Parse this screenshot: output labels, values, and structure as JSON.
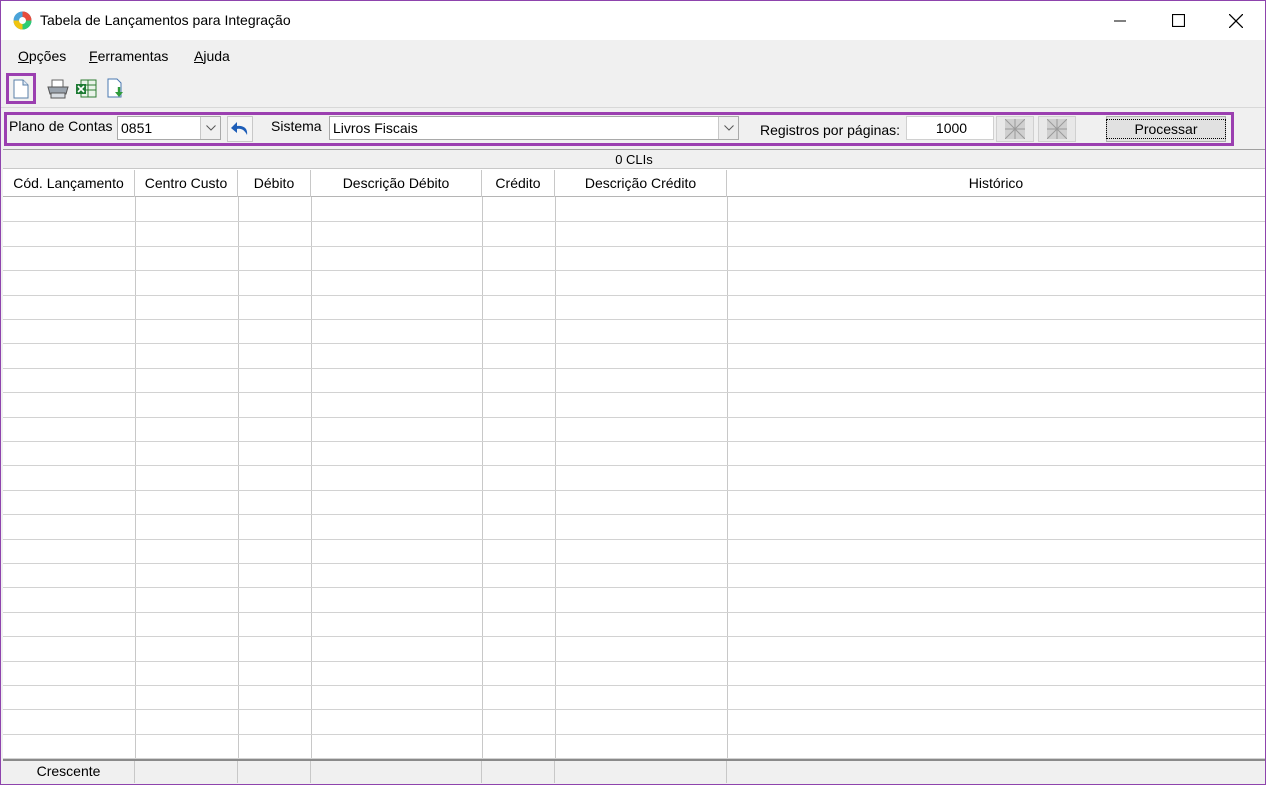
{
  "window": {
    "title": "Tabela de Lançamentos para Integração"
  },
  "menu": {
    "opcoes": {
      "hotkey": "O",
      "rest": "pções"
    },
    "ferramentas": {
      "hotkey": "F",
      "rest": "erramentas"
    },
    "ajuda": {
      "hotkey": "A",
      "rest": "juda"
    }
  },
  "toolbar": {
    "icons": [
      "new-document-icon",
      "print-icon",
      "excel-export-icon",
      "import-icon"
    ]
  },
  "filters": {
    "plano_label": "Plano de Contas",
    "plano_value": "0851",
    "sistema_label": "Sistema",
    "sistema_value": "Livros Fiscais",
    "registros_label": "Registros por páginas:",
    "registros_value": "1000",
    "processar_label": "Processar"
  },
  "grid": {
    "count_text": "0 CLIs",
    "columns": [
      "Cód. Lançamento",
      "Centro Custo",
      "Débito",
      "Descrição Débito",
      "Crédito",
      "Descrição Crédito",
      "Histórico"
    ],
    "footer": [
      "Crescente",
      "",
      "",
      "",
      "",
      "",
      ""
    ],
    "empty_row_count": 23
  },
  "colors": {
    "highlight": "#9b3fb0",
    "window_border": "#8e44ad"
  }
}
